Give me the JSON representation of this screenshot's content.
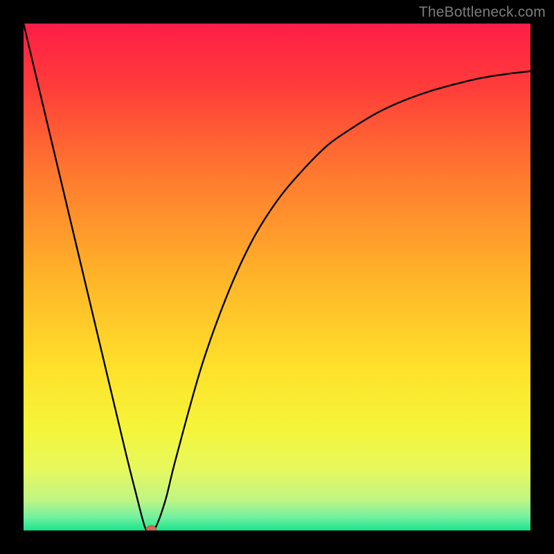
{
  "watermark": "TheBottleneck.com",
  "chart_data": {
    "type": "line",
    "title": "",
    "xlabel": "",
    "ylabel": "",
    "xlim": [
      0,
      100
    ],
    "ylim": [
      0,
      100
    ],
    "x": [
      0,
      5,
      10,
      15,
      20,
      22,
      24,
      25,
      26,
      28,
      30,
      35,
      40,
      45,
      50,
      55,
      60,
      65,
      70,
      75,
      80,
      85,
      90,
      95,
      100
    ],
    "values": [
      100,
      79,
      58,
      37,
      16,
      8,
      0.5,
      0.2,
      0.5,
      6,
      14,
      32,
      46,
      57,
      65,
      71,
      76,
      79.5,
      82.5,
      84.8,
      86.6,
      88,
      89.2,
      90,
      90.6
    ],
    "marker": {
      "x": 25.2,
      "y": 0.2
    },
    "gradient_stops": [
      {
        "offset": 0.0,
        "color": "#ff1d47"
      },
      {
        "offset": 0.12,
        "color": "#ff3b3a"
      },
      {
        "offset": 0.3,
        "color": "#ff7a2f"
      },
      {
        "offset": 0.5,
        "color": "#ffb429"
      },
      {
        "offset": 0.68,
        "color": "#ffe12a"
      },
      {
        "offset": 0.8,
        "color": "#f4f53a"
      },
      {
        "offset": 0.88,
        "color": "#e7f85e"
      },
      {
        "offset": 0.94,
        "color": "#bff584"
      },
      {
        "offset": 0.975,
        "color": "#6ff0a0"
      },
      {
        "offset": 1.0,
        "color": "#19e48c"
      }
    ]
  }
}
